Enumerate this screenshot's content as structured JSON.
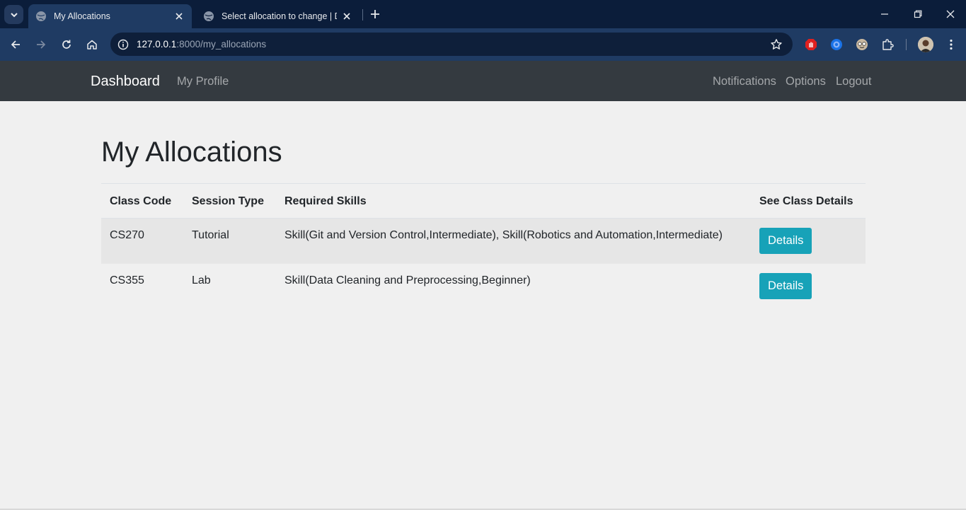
{
  "browser": {
    "tabs": [
      {
        "title": "My Allocations",
        "active": true
      },
      {
        "title": "Select allocation to change | Dja",
        "active": false
      }
    ],
    "url_host": "127.0.0.1",
    "url_rest": ":8000/my_allocations",
    "icons": {
      "tab_search": "chevron-down-icon",
      "back": "arrow-left-icon",
      "forward": "arrow-right-icon",
      "reload": "reload-icon",
      "home": "home-icon",
      "site_info": "info-icon",
      "bookmark": "star-icon",
      "extensions": [
        "adblock-icon",
        "translate-icon",
        "face-extension-icon",
        "puzzle-icon"
      ],
      "menu": "kebab-menu-icon"
    }
  },
  "nav": {
    "brand": "Dashboard",
    "left_links": [
      "My Profile"
    ],
    "right_links": [
      "Notifications",
      "Options",
      "Logout"
    ]
  },
  "page": {
    "title": "My Allocations",
    "table": {
      "headers": [
        "Class Code",
        "Session Type",
        "Required Skills",
        "See Class Details"
      ],
      "rows": [
        {
          "class_code": "CS270",
          "session_type": "Tutorial",
          "required_skills": "Skill(Git and Version Control,Intermediate), Skill(Robotics and Automation,Intermediate)",
          "action": "Details"
        },
        {
          "class_code": "CS355",
          "session_type": "Lab",
          "required_skills": "Skill(Data Cleaning and Preprocessing,Beginner)",
          "action": "Details"
        }
      ]
    }
  },
  "colors": {
    "browser_frame": "#0b1d3a",
    "browser_toolbar": "#1f3b63",
    "navbar": "#343a40",
    "page_bg": "#f0f0f0",
    "details_button": "#17a2b8"
  }
}
